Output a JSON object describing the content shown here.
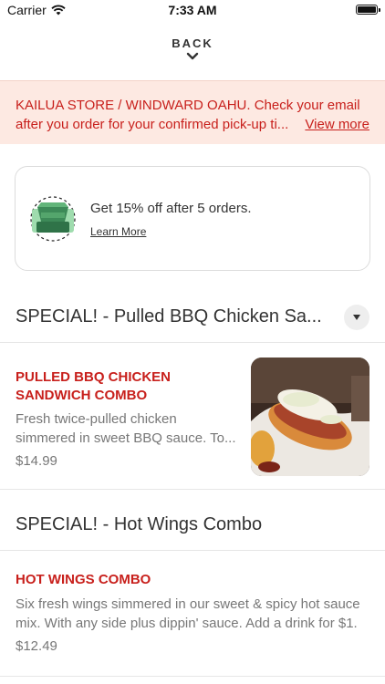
{
  "status_bar": {
    "carrier": "Carrier",
    "time": "7:33 AM"
  },
  "back": {
    "label": "BACK"
  },
  "banner": {
    "line1": "KAILUA STORE / WINDWARD OAHU. Check your email",
    "line2": "after you order for your confirmed pick-up ti...",
    "link": "View more"
  },
  "reward": {
    "text": "Get 15% off after 5 orders.",
    "link": "Learn More"
  },
  "sections": [
    {
      "title": "SPECIAL! - Pulled BBQ Chicken Sa...",
      "items": [
        {
          "name_line1": "PULLED BBQ CHICKEN",
          "name_line2": "SANDWICH COMBO",
          "desc_line1": "Fresh twice-pulled chicken",
          "desc_line2": "simmered in sweet BBQ sauce. To...",
          "price": "$14.99"
        }
      ]
    },
    {
      "title": "SPECIAL! - Hot Wings Combo",
      "items": [
        {
          "name_line1": "HOT WINGS COMBO",
          "desc_line1": "Six fresh wings simmered in our sweet & spicy hot sauce",
          "desc_line2": "mix. With any side plus dippin' sauce. Add a drink for $1.",
          "price": "$12.49"
        }
      ]
    }
  ],
  "colors": {
    "accent": "#c8201c",
    "banner_bg": "#fde9e2",
    "text": "#333333",
    "muted": "#777777"
  }
}
